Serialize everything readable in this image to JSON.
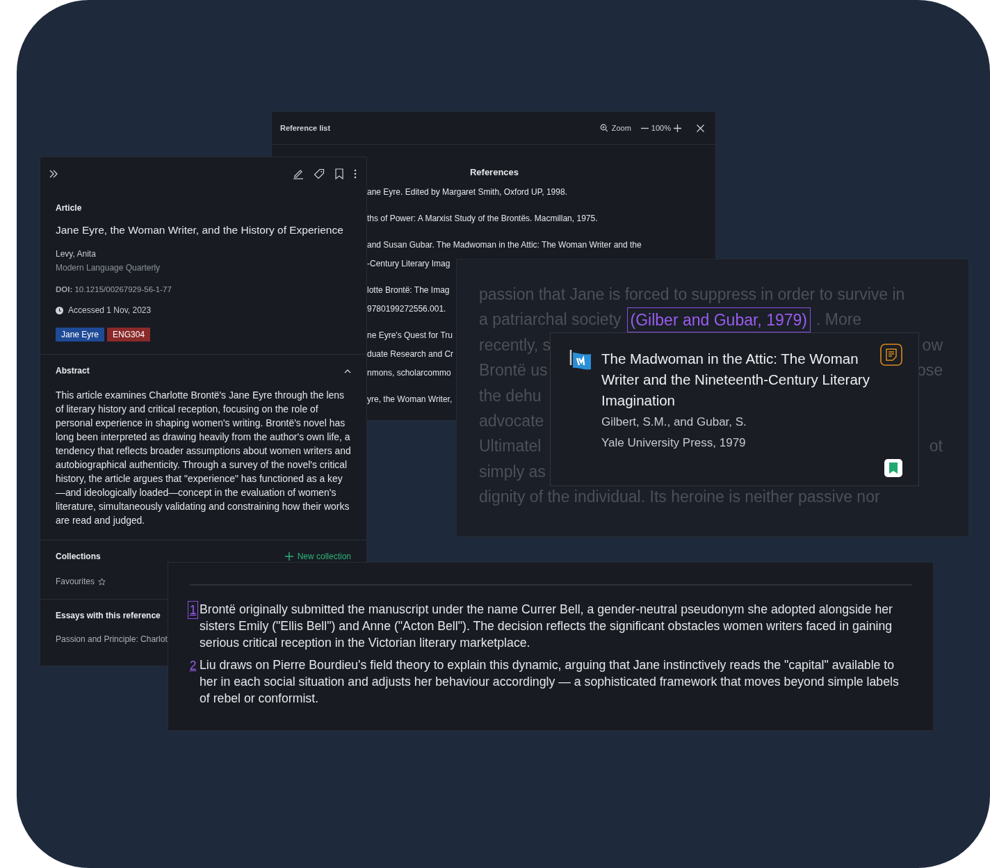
{
  "reference_list": {
    "title": "Reference list",
    "zoom_label": "Zoom",
    "zoom_level": "100%",
    "heading": "References",
    "entries": [
      {
        "lines": [
          "ane Eyre. Edited by Margaret Smith, Oxford UP, 1998."
        ]
      },
      {
        "lines": [
          "ths of Power: A Marxist Study of the Brontës. Macmillan, 1975."
        ]
      },
      {
        "lines": [
          "and Susan Gubar. The Madwoman in the Attic: The Woman Writer and the",
          "-Century Literary Imag"
        ]
      },
      {
        "lines": [
          "lotte Brontë: The Imag",
          "9780199272556.001."
        ]
      },
      {
        "lines": [
          "ne Eyre's Quest for Tru",
          "duate Research and Cr",
          "nmons, scholarcommo"
        ]
      },
      {
        "lines": [
          "yre, the Woman Writer,"
        ]
      }
    ]
  },
  "article_panel": {
    "type_label": "Article",
    "title": "Jane Eyre, the Woman Writer, and the History of Experience",
    "author": "Levy, Anita",
    "journal": "Modern Language Quarterly",
    "doi_label": "DOI:",
    "doi": "10.1215/00267929-56-1-77",
    "accessed": "Accessed 1 Nov, 2023",
    "tags": [
      {
        "label": "Jane Eyre",
        "color": "#1f4a96"
      },
      {
        "label": "ENG304",
        "color": "#8a2a2a"
      }
    ],
    "abstract": {
      "heading": "Abstract",
      "expanded": true,
      "text": "This article examines Charlotte Brontë's Jane Eyre through the lens of literary history and critical reception, focusing on the role of personal experience in shaping women's writing. Brontë's novel has long been interpreted as drawing heavily from the author's own life, a tendency that reflects broader assumptions about women writers and autobiographical authenticity. Through a survey of the novel's critical history, the article argues that \"experience\" has functioned as a key—and ideologically loaded—concept in the evaluation of women's literature, simultaneously validating and constraining how their works are read and judged."
    },
    "collections": {
      "heading": "Collections",
      "new_button": "New collection",
      "items": [
        "Favourites"
      ]
    },
    "essays": {
      "heading": "Essays with this reference",
      "items": [
        "Passion and Principle: Charlot"
      ]
    }
  },
  "reader": {
    "lines": [
      {
        "kind": "text",
        "text": "passion that Jane is forced to suppress in order to survive in"
      },
      {
        "kind": "citation",
        "before": "a patriarchal society",
        "citation": "(Gilber and Gubar, 1979)",
        "after": ". More"
      },
      {
        "kind": "split",
        "left": "recently, s",
        "right": "ow"
      },
      {
        "kind": "split",
        "left": "Brontë us",
        "right": "ose"
      },
      {
        "kind": "split",
        "left": "the dehu"
      },
      {
        "kind": "split",
        "left": "advocate"
      },
      {
        "kind": "split",
        "left": "Ultimatel",
        "right": "ot"
      },
      {
        "kind": "split",
        "left": "simply as"
      },
      {
        "kind": "text",
        "text": "dignity of the individual. Its heroine is neither passive nor"
      }
    ]
  },
  "citation_popup": {
    "title": "The Madwoman in the Attic: The Woman Writer and the Nineteenth-Century Literary Imagination",
    "authors": "Gilbert, S.M., and Gubar, S.",
    "publisher": "Yale University Press, 1979"
  },
  "footnotes": [
    {
      "number": "1",
      "selected": true,
      "text": "Brontë originally submitted the manuscript under the name Currer Bell, a gender-neutral pseudonym she adopted alongside her sisters Emily (\"Ellis Bell\") and Anne (\"Acton Bell\"). The decision reflects the significant obstacles women writers faced in gaining serious critical reception in the Victorian literary marketplace."
    },
    {
      "number": "2",
      "selected": false,
      "text": "Liu draws on Pierre Bourdieu's field theory to explain this dynamic, arguing that Jane instinctively reads the \"capital\" available to her in each social situation and adjusts her behaviour accordingly — a sophisticated framework that moves beyond simple labels of rebel or conformist."
    }
  ]
}
